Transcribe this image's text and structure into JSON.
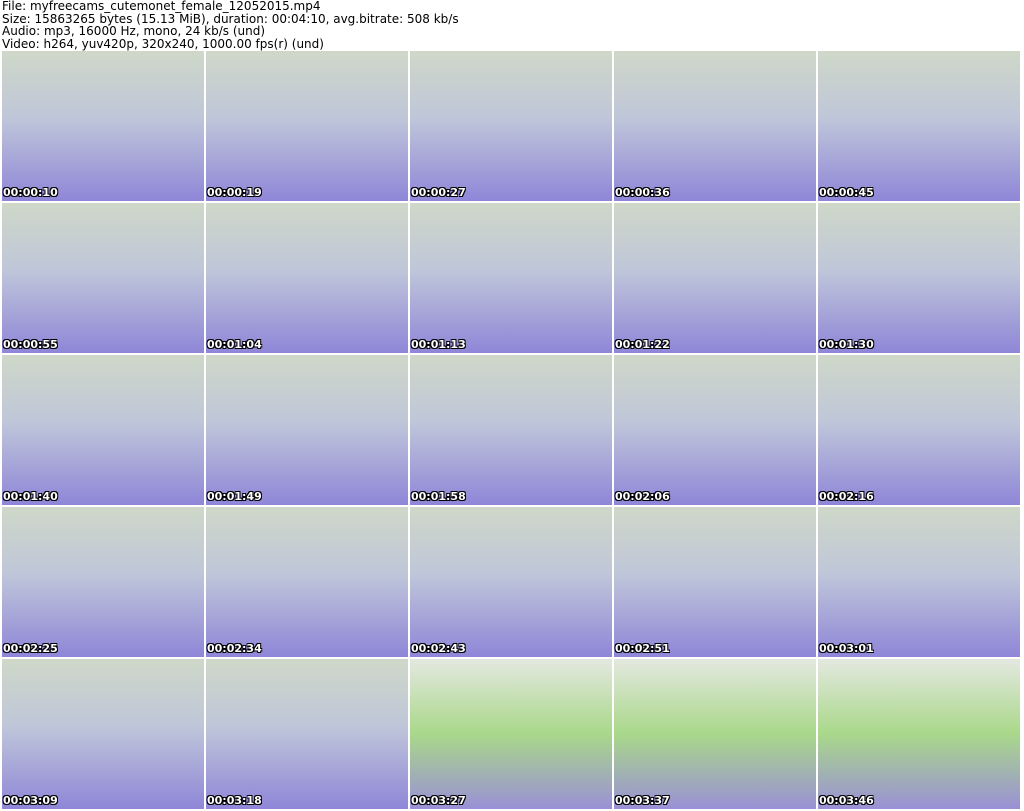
{
  "header": {
    "file": "File: myfreecams_cutemonet_female_12052015.mp4",
    "size": "Size: 15863265 bytes (15.13 MiB), duration: 00:04:10, avg.bitrate: 508 kb/s",
    "audio": "Audio: mp3, 16000 Hz, mono, 24 kb/s (und)",
    "video": "Video: h264, yuv420p, 320x240, 1000.00 fps(r) (und)"
  },
  "thumbnails": [
    "00:00:10",
    "00:00:19",
    "00:00:27",
    "00:00:36",
    "00:00:45",
    "00:00:55",
    "00:01:04",
    "00:01:13",
    "00:01:22",
    "00:01:30",
    "00:01:40",
    "00:01:49",
    "00:01:58",
    "00:02:06",
    "00:02:16",
    "00:02:25",
    "00:02:34",
    "00:02:43",
    "00:02:51",
    "00:03:01",
    "00:03:09",
    "00:03:18",
    "00:03:27",
    "00:03:37",
    "00:03:46"
  ]
}
